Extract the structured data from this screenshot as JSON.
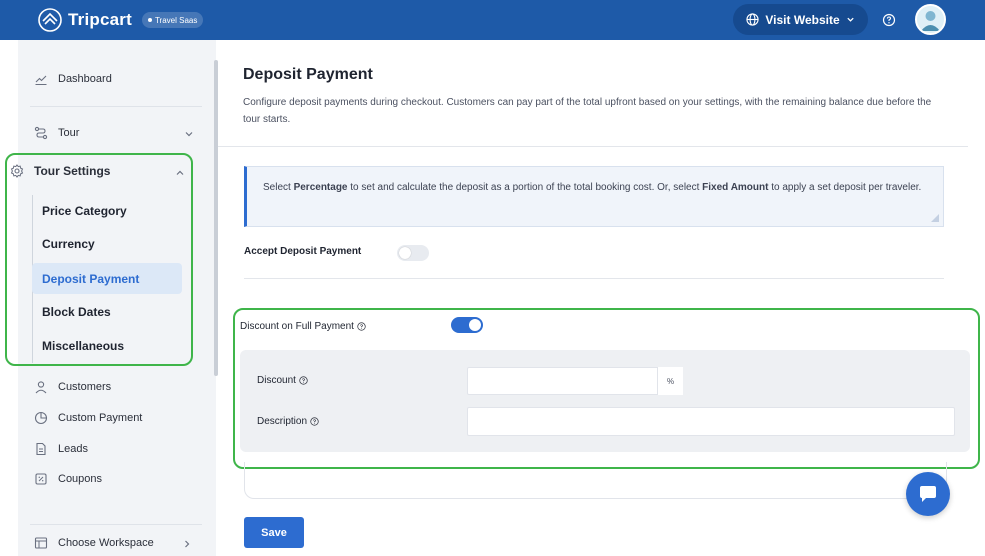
{
  "brand": {
    "name": "Tripcart",
    "badge": "Travel Saas"
  },
  "topbar": {
    "visit_label": "Visit Website"
  },
  "sidebar": {
    "dashboard": "Dashboard",
    "tour": "Tour",
    "tour_settings": "Tour Settings",
    "sub_items": [
      "Price Category",
      "Currency",
      "Deposit Payment",
      "Block Dates",
      "Miscellaneous"
    ],
    "active_sub": "Deposit Payment",
    "customers": "Customers",
    "custom_payment": "Custom Payment",
    "leads": "Leads",
    "coupons": "Coupons",
    "workspace": "Choose Workspace"
  },
  "page": {
    "title": "Deposit Payment",
    "description": "Configure deposit payments during checkout. Customers can pay part of the total upfront based on your settings, with the remaining balance due before the tour starts.",
    "info_prefix": "Select ",
    "info_pct": "Percentage",
    "info_mid": " to set and calculate the deposit as a portion of the total booking cost. Or, select ",
    "info_fixed": "Fixed Amount",
    "info_suffix": " to apply a set deposit per traveler.",
    "accept_deposit_label": "Accept Deposit Payment",
    "accept_deposit_on": false,
    "full_discount_label": "Discount on Full Payment",
    "full_discount_on": true,
    "discount_label": "Discount",
    "discount_value": "",
    "discount_suffix": "%",
    "description_label": "Description",
    "description_value": "",
    "save_label": "Save"
  },
  "colors": {
    "primary": "#2d6cd0",
    "topbar": "#1e5aa8",
    "highlight": "#3fb54a"
  }
}
